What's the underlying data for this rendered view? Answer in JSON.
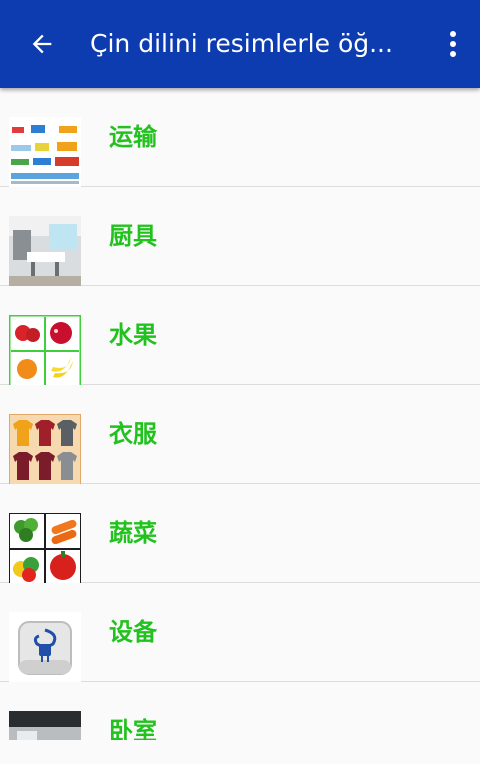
{
  "appbar": {
    "title": "Çin dilini resimlerle öğ...",
    "back_icon": "arrow-back-icon",
    "menu_icon": "more-vert-icon",
    "color": "#0d3bb0"
  },
  "list": {
    "label_color": "#22c21e",
    "items": [
      {
        "label": "运输",
        "thumb": "transport-thumbnail"
      },
      {
        "label": "厨具",
        "thumb": "kitchen-thumbnail"
      },
      {
        "label": "水果",
        "thumb": "fruits-thumbnail"
      },
      {
        "label": "衣服",
        "thumb": "clothes-thumbnail"
      },
      {
        "label": "蔬菜",
        "thumb": "vegetables-thumbnail"
      },
      {
        "label": "设备",
        "thumb": "plug-device-thumbnail"
      },
      {
        "label": "卧室",
        "thumb": "bedroom-thumbnail"
      }
    ]
  }
}
